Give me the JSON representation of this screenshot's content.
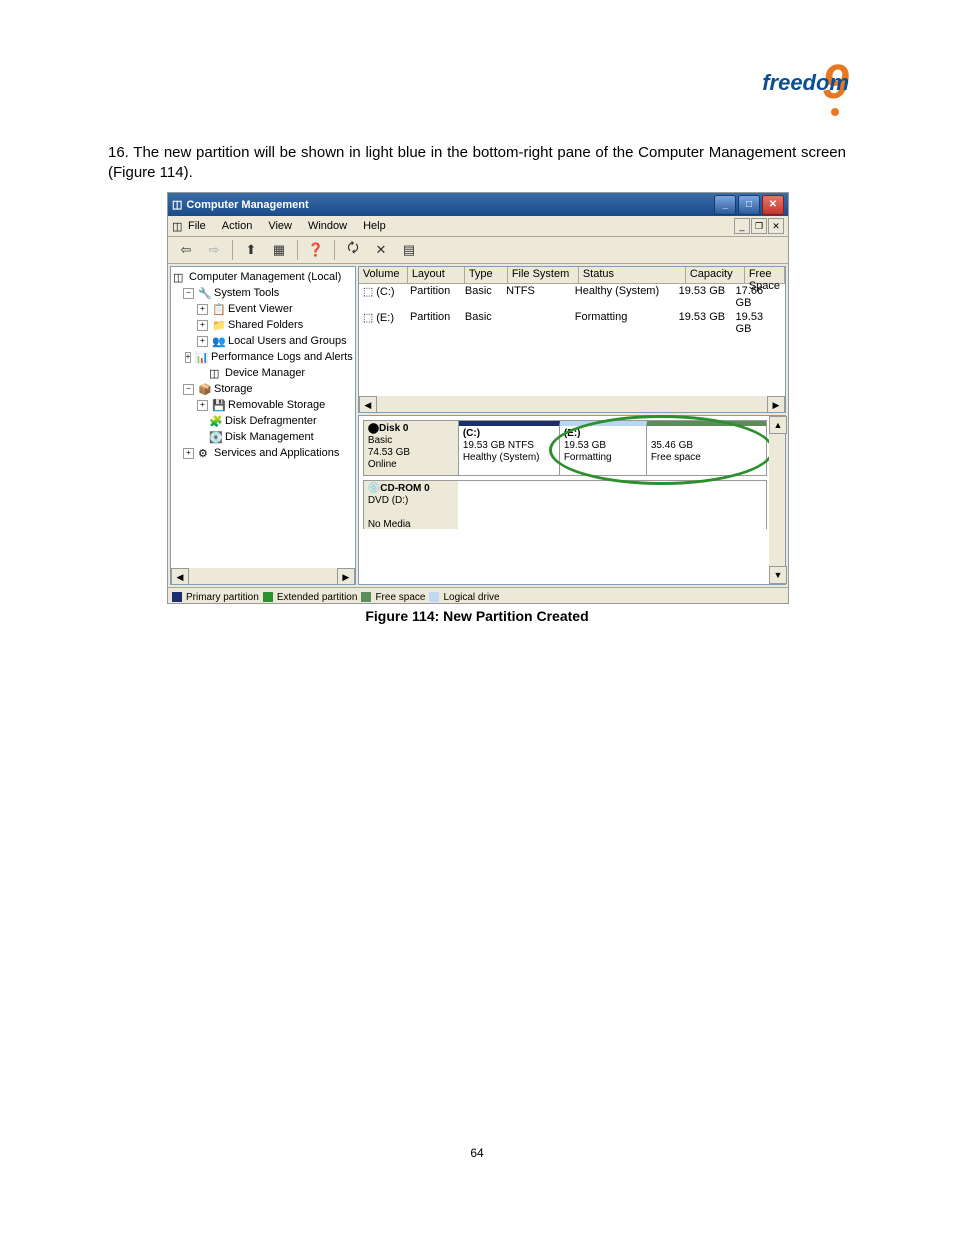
{
  "logo": {
    "text": "freedom",
    "nine": "9"
  },
  "step": {
    "number": "16.",
    "text": "The new partition will be shown in light blue in the bottom-right pane of the Computer Management screen (Figure 114)."
  },
  "window": {
    "title": "Computer Management",
    "menu": [
      "File",
      "Action",
      "View",
      "Window",
      "Help"
    ]
  },
  "tree": {
    "root": "Computer Management (Local)",
    "system_tools": "System Tools",
    "event_viewer": "Event Viewer",
    "shared_folders": "Shared Folders",
    "local_users": "Local Users and Groups",
    "perf_logs": "Performance Logs and Alerts",
    "device_mgr": "Device Manager",
    "storage": "Storage",
    "removable": "Removable Storage",
    "defrag": "Disk Defragmenter",
    "disk_mgmt": "Disk Management",
    "services": "Services and Applications"
  },
  "vol_headers": {
    "volume": "Volume",
    "layout": "Layout",
    "type": "Type",
    "filesystem": "File System",
    "status": "Status",
    "capacity": "Capacity",
    "freespace": "Free Space"
  },
  "vols": [
    {
      "vol": "(C:)",
      "layout": "Partition",
      "type": "Basic",
      "fs": "NTFS",
      "status": "Healthy (System)",
      "cap": "19.53 GB",
      "free": "17.66 GB"
    },
    {
      "vol": "(E:)",
      "layout": "Partition",
      "type": "Basic",
      "fs": "",
      "status": "Formatting",
      "cap": "19.53 GB",
      "free": "19.53 GB"
    }
  ],
  "disk0": {
    "name": "Disk 0",
    "type": "Basic",
    "size": "74.53 GB",
    "status": "Online",
    "parts": [
      {
        "label": "(C:)",
        "line2": "19.53 GB NTFS",
        "line3": "Healthy (System)"
      },
      {
        "label": "(E:)",
        "line2": "19.53 GB",
        "line3": "Formatting"
      },
      {
        "label": "",
        "line2": "35.46 GB",
        "line3": "Free space"
      }
    ]
  },
  "cdrom": {
    "name": "CD-ROM 0",
    "drive": "DVD (D:)",
    "status": "No Media"
  },
  "legend": {
    "primary": "Primary partition",
    "extended": "Extended partition",
    "free": "Free space",
    "logical": "Logical drive"
  },
  "figure_caption": "Figure 114: New Partition Created",
  "page_number": "64"
}
